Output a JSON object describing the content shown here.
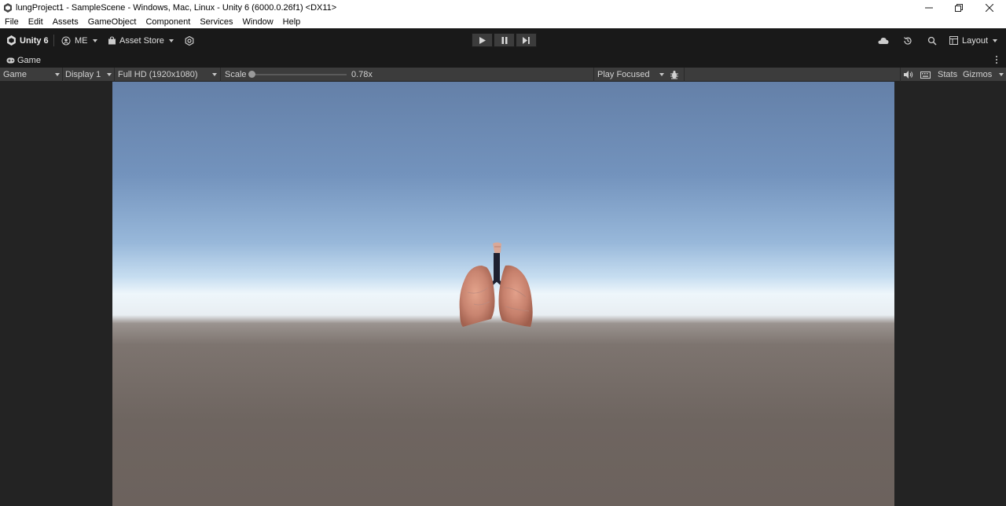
{
  "window": {
    "title": "lungProject1 - SampleScene - Windows, Mac, Linux - Unity 6 (6000.0.26f1) <DX11>",
    "controls": [
      "minimize",
      "restore",
      "close"
    ]
  },
  "menu": [
    "File",
    "Edit",
    "Assets",
    "GameObject",
    "Component",
    "Services",
    "Window",
    "Help"
  ],
  "toolbar": {
    "unity_label": "Unity 6",
    "account_label": "ME",
    "asset_store_label": "Asset Store",
    "layout_label": "Layout"
  },
  "tab": {
    "label": "Game"
  },
  "gamebar": {
    "mode": "Game",
    "display": "Display 1",
    "resolution": "Full HD (1920x1080)",
    "scale_label": "Scale",
    "scale_value": "0.78x",
    "scale_fraction": 0.0,
    "play_mode": "Play Focused",
    "stats_label": "Stats",
    "gizmos_label": "Gizmos"
  },
  "icons": [
    "unity-logo-icon",
    "account-icon",
    "asset-store-bag-icon",
    "settings-icon",
    "play-icon",
    "pause-icon",
    "step-icon",
    "cloud-icon",
    "history-icon",
    "search-icon",
    "layout-icon",
    "gamepad-icon",
    "kebab-menu-icon",
    "bug-icon",
    "speaker-icon",
    "keyboard-icon"
  ],
  "colors": {
    "editor_bg": "#191919",
    "bar_bg": "#3c3c3c",
    "sky_top": "#6480a8",
    "horizon": "#eef6fb",
    "ground": "#6c625d"
  }
}
